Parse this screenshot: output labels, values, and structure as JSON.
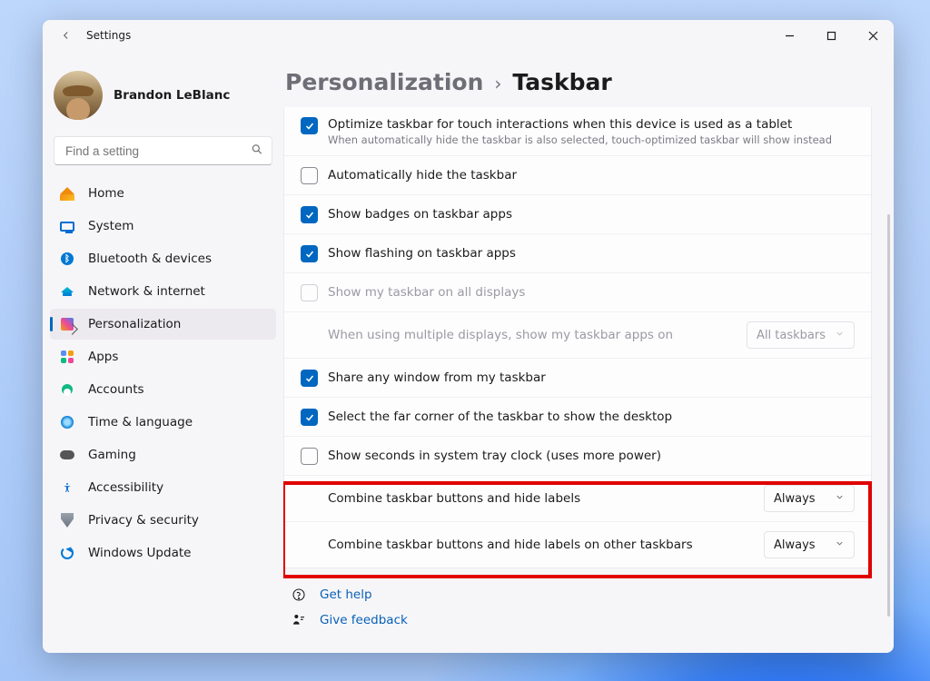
{
  "window": {
    "title": "Settings"
  },
  "profile": {
    "name": "Brandon LeBlanc"
  },
  "search": {
    "placeholder": "Find a setting"
  },
  "sidebar": {
    "items": [
      {
        "label": "Home"
      },
      {
        "label": "System"
      },
      {
        "label": "Bluetooth & devices"
      },
      {
        "label": "Network & internet"
      },
      {
        "label": "Personalization"
      },
      {
        "label": "Apps"
      },
      {
        "label": "Accounts"
      },
      {
        "label": "Time & language"
      },
      {
        "label": "Gaming"
      },
      {
        "label": "Accessibility"
      },
      {
        "label": "Privacy & security"
      },
      {
        "label": "Windows Update"
      }
    ],
    "selectedIndex": 4
  },
  "breadcrumb": {
    "parent": "Personalization",
    "page": "Taskbar"
  },
  "rows": {
    "optimize": {
      "label": "Optimize taskbar for touch interactions when this device is used as a tablet",
      "sub": "When automatically hide the taskbar is also selected, touch-optimized taskbar will show instead",
      "checked": true
    },
    "autohide": {
      "label": "Automatically hide the taskbar",
      "checked": false
    },
    "badges": {
      "label": "Show badges on taskbar apps",
      "checked": true
    },
    "flashing": {
      "label": "Show flashing on taskbar apps",
      "checked": true
    },
    "multimon": {
      "label": "Show my taskbar on all displays",
      "checked": false
    },
    "multiapps": {
      "label": "When using multiple displays, show my taskbar apps on",
      "value": "All taskbars"
    },
    "sharewin": {
      "label": "Share any window from my taskbar",
      "checked": true
    },
    "farcorner": {
      "label": "Select the far corner of the taskbar to show the desktop",
      "checked": true
    },
    "seconds": {
      "label": "Show seconds in system tray clock (uses more power)",
      "checked": false
    },
    "combine1": {
      "label": "Combine taskbar buttons and hide labels",
      "value": "Always"
    },
    "combine2": {
      "label": "Combine taskbar buttons and hide labels on other taskbars",
      "value": "Always"
    }
  },
  "footer": {
    "help": "Get help",
    "feedback": "Give feedback"
  }
}
